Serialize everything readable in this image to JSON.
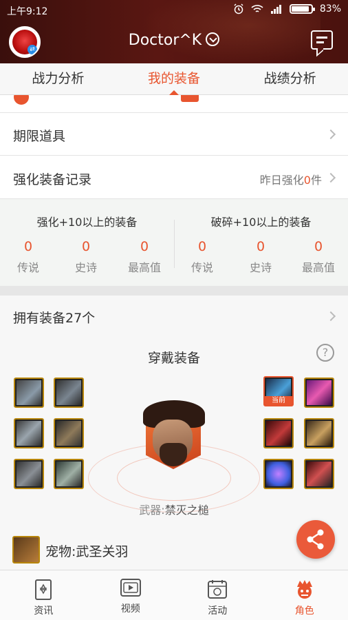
{
  "status_bar": {
    "time": "上午9:12",
    "battery": "83%",
    "battery_level": 0.83
  },
  "header": {
    "username": "Doctor^K"
  },
  "tabs": [
    {
      "label": "战力分析",
      "active": false
    },
    {
      "label": "我的装备",
      "active": true
    },
    {
      "label": "战绩分析",
      "active": false
    }
  ],
  "rows": {
    "limited_items": "期限道具",
    "enhance_record": {
      "label": "强化装备记录",
      "prefix": "昨日强化",
      "count": "0",
      "suffix": "件"
    }
  },
  "stats": {
    "left": {
      "title": "强化+10以上的装备",
      "items": [
        {
          "value": "0",
          "label": "传说"
        },
        {
          "value": "0",
          "label": "史诗"
        },
        {
          "value": "0",
          "label": "最高值"
        }
      ]
    },
    "right": {
      "title": "破碎+10以上的装备",
      "items": [
        {
          "value": "0",
          "label": "传说"
        },
        {
          "value": "0",
          "label": "史诗"
        },
        {
          "value": "0",
          "label": "最高值"
        }
      ]
    }
  },
  "equipment": {
    "owned_label": "拥有装备27个",
    "wearing_title": "穿戴装备",
    "help_symbol": "?",
    "current_tag": "当前",
    "weapon_key": "武器:",
    "weapon_name": "禁灭之槌",
    "pet_label": "宠物:武圣关羽"
  },
  "bottom_nav": [
    {
      "label": "资讯",
      "icon": "news-icon",
      "active": false
    },
    {
      "label": "视频",
      "icon": "video-icon",
      "active": false
    },
    {
      "label": "活动",
      "icon": "activity-icon",
      "active": false
    },
    {
      "label": "角色",
      "icon": "character-icon",
      "active": true
    }
  ],
  "colors": {
    "accent": "#e8552f",
    "header_bg": "#4a120e"
  }
}
